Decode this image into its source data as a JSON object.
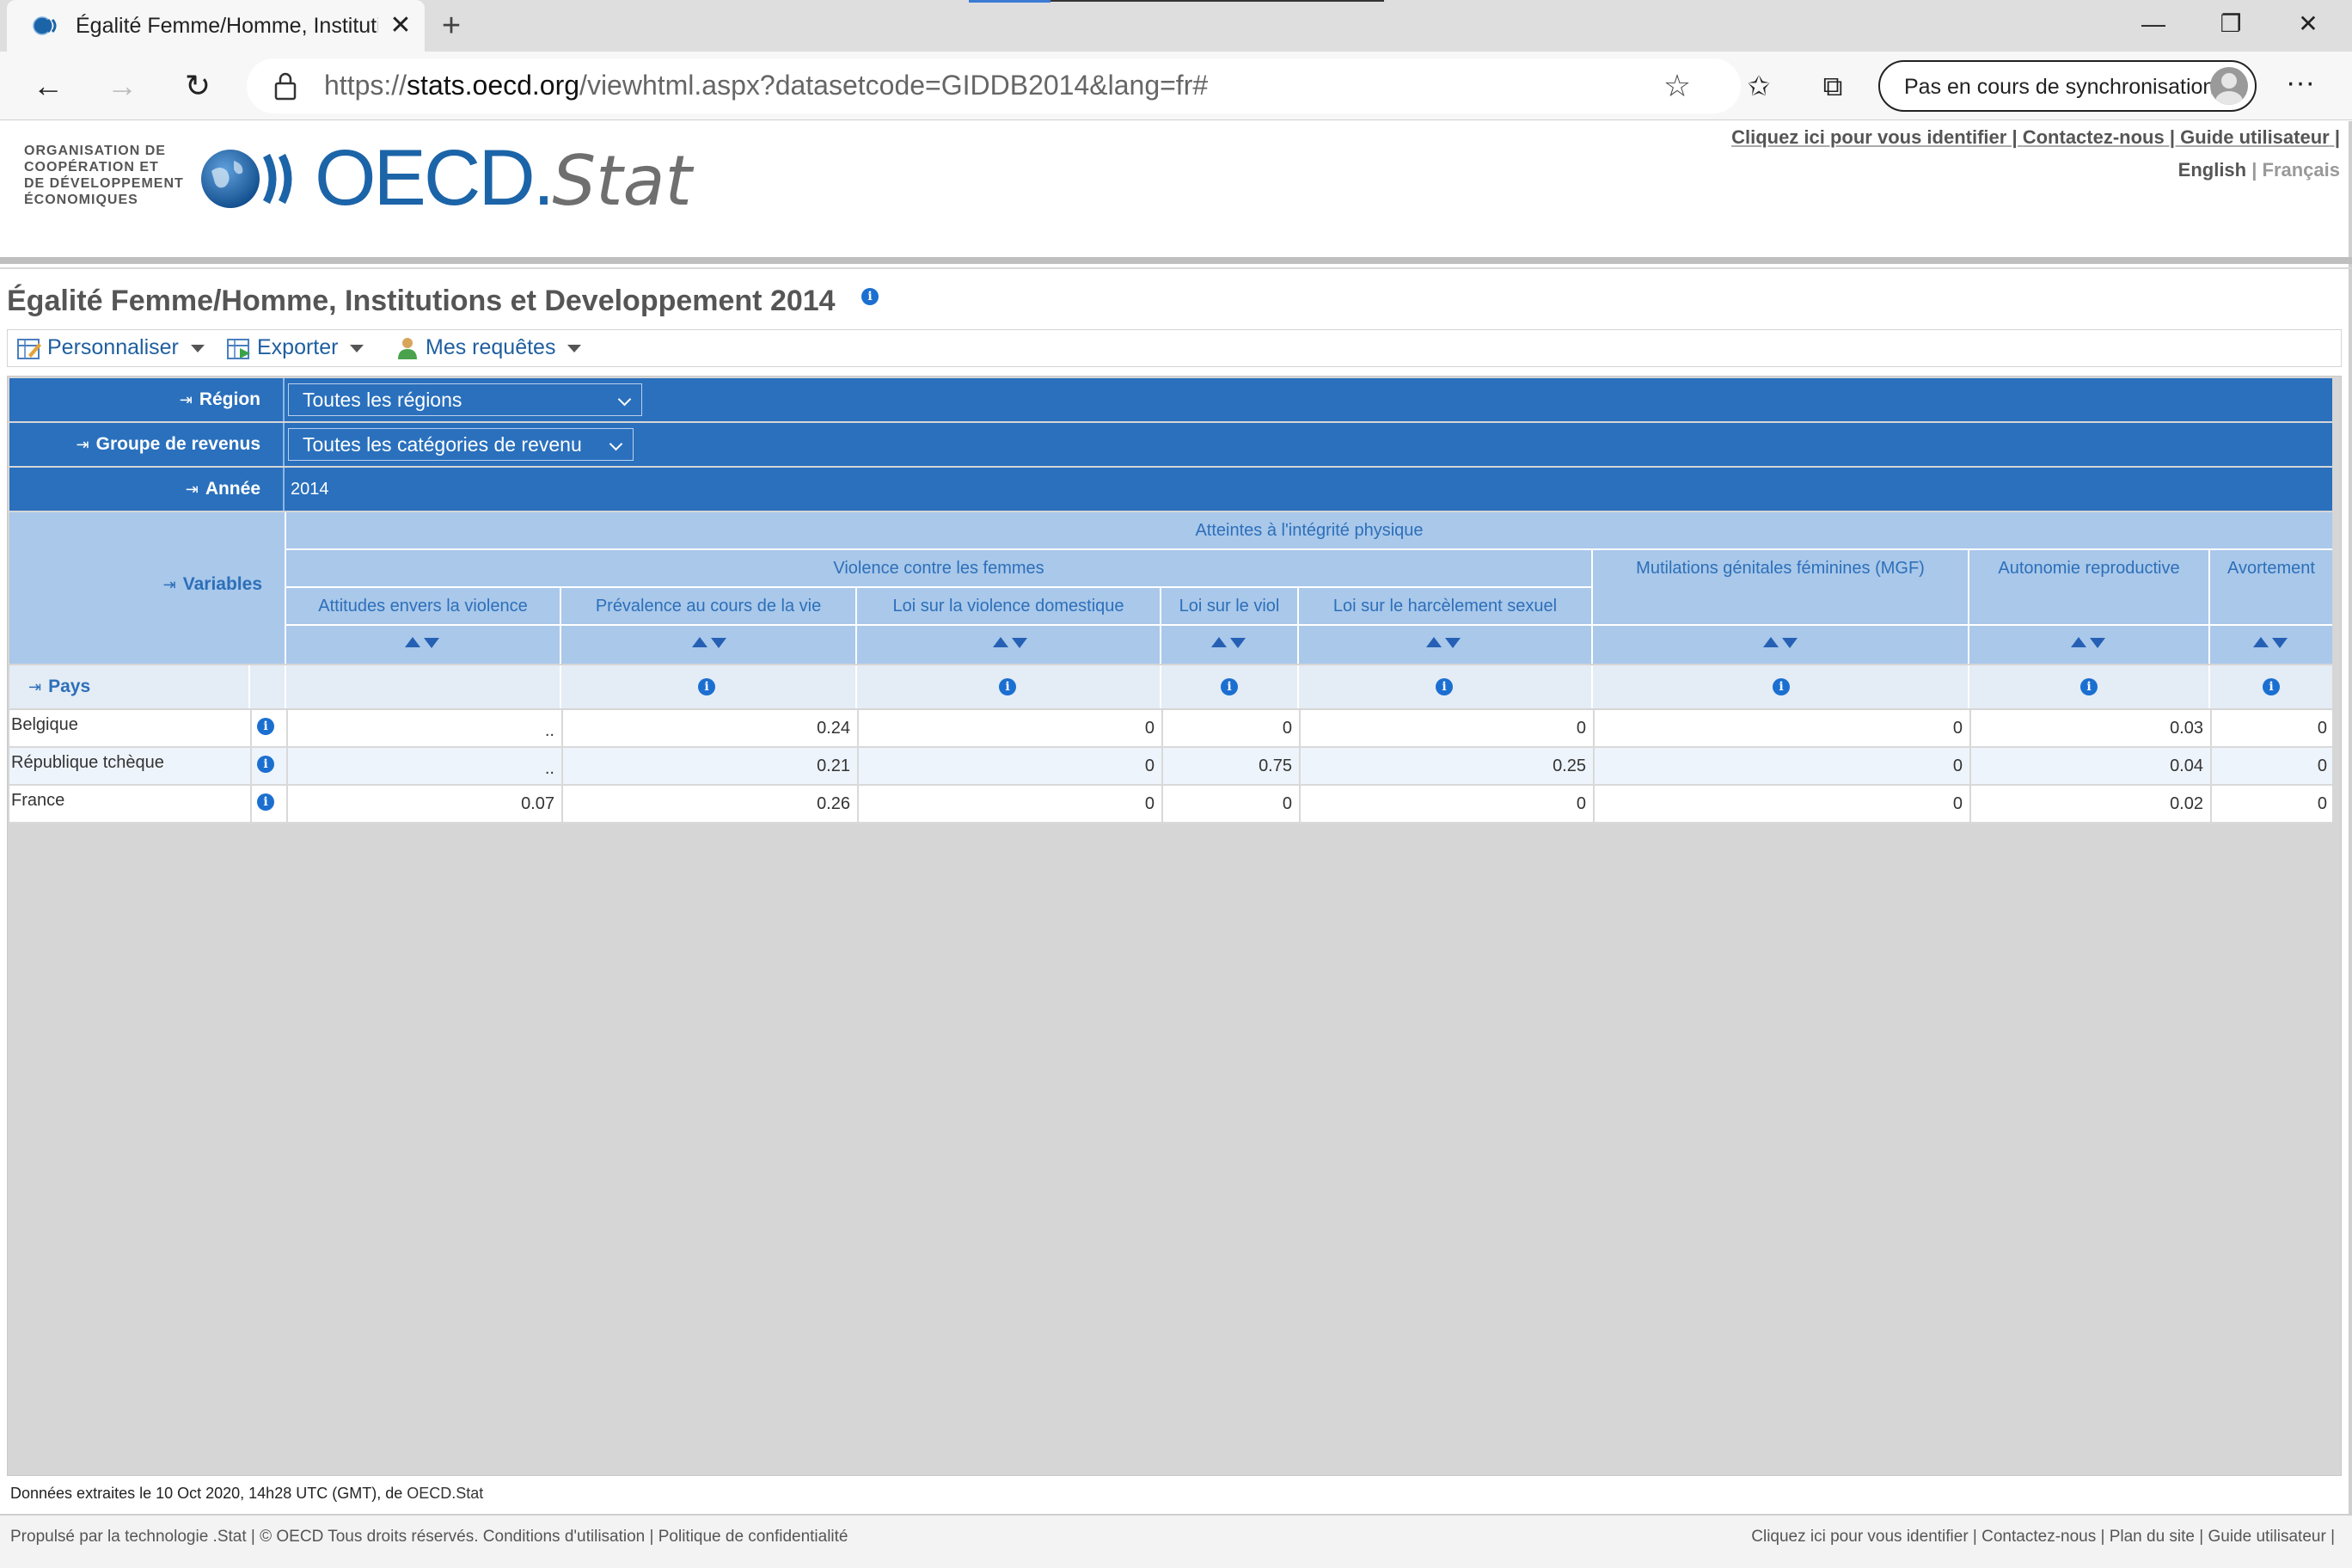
{
  "browser": {
    "tab_title": "Égalité Femme/Homme, Institutio",
    "url_prefix": "https://",
    "url_host": "stats.oecd.org",
    "url_path": "/viewhtml.aspx?datasetcode=GIDDB2014&lang=fr#",
    "sync_label": "Pas en cours de synchronisation"
  },
  "header": {
    "org_lines": [
      "ORGANISATION DE",
      "COOPÉRATION ET",
      "DE DÉVELOPPEMENT",
      "ÉCONOMIQUES"
    ],
    "brand_main": "OECD.",
    "brand_stat": "Stat",
    "links": [
      "Cliquez ici pour vous identifier",
      "Contactez-nous",
      "Guide utilisateur"
    ],
    "lang_en": "English",
    "lang_fr": "Français"
  },
  "page": {
    "title": "Égalité Femme/Homme, Institutions et Developpement 2014"
  },
  "toolbar": {
    "customize": "Personnaliser",
    "export": "Exporter",
    "queries": "Mes requêtes"
  },
  "filters": {
    "region_label": "Région",
    "region_value": "Toutes les régions",
    "income_label": "Groupe de revenus",
    "income_value": "Toutes les catégories de revenu",
    "year_label": "Année",
    "year_value": "2014"
  },
  "table": {
    "variables_label": "Variables",
    "pays_label": "Pays",
    "group_top": "Atteintes à l'intégrité physique",
    "group_violence": "Violence contre les femmes",
    "columns": [
      "Attitudes envers la violence",
      "Prévalence au cours de la vie",
      "Loi sur la violence domestique",
      "Loi sur le viol",
      "Loi sur le harcèlement sexuel",
      "Mutilations génitales féminines (MGF)",
      "Autonomie reproductive",
      "Avortement"
    ],
    "rows": [
      {
        "country": "Belgique",
        "values": [
          "..",
          "0.24",
          "0",
          "0",
          "0",
          "0",
          "0.03",
          "0"
        ]
      },
      {
        "country": "République tchèque",
        "values": [
          "..",
          "0.21",
          "0",
          "0.75",
          "0.25",
          "0",
          "0.04",
          "0"
        ]
      },
      {
        "country": "France",
        "values": [
          "0.07",
          "0.26",
          "0",
          "0",
          "0",
          "0",
          "0.02",
          "0"
        ]
      }
    ]
  },
  "footer": {
    "extract_text": "Données extraites le 10 Oct 2020, 14h28 UTC (GMT), de ",
    "extract_source": "OECD.Stat",
    "left": "Propulsé par la technologie .Stat | © OECD Tous droits réservés. Conditions d'utilisation |  Politique de confidentialité",
    "right": "Cliquez ici pour vous identifier | Contactez-nous |  Plan du site |  Guide utilisateur |"
  },
  "colors": {
    "filter_blue": "#2a70bd",
    "header_blue": "#a9c8ea",
    "link_blue": "#1f5fa0"
  }
}
